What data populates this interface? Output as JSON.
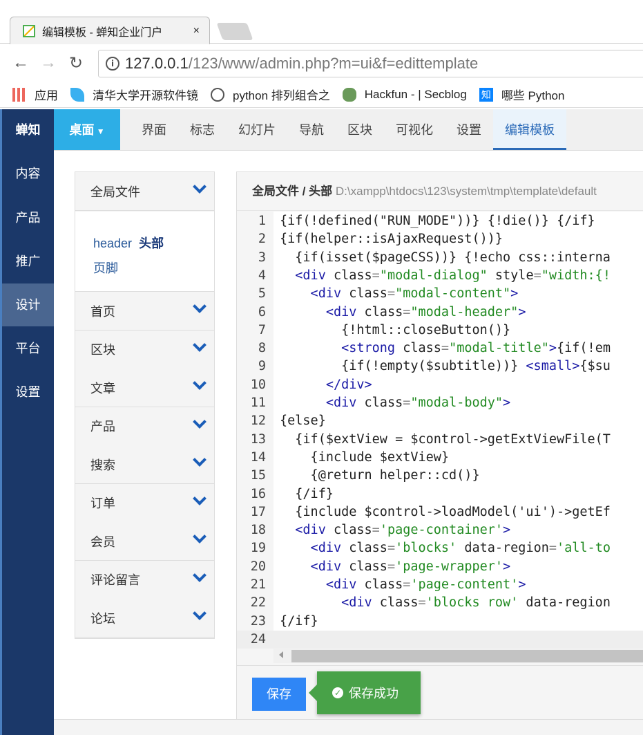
{
  "browser": {
    "tab_title": "编辑模板 - 蝉知企业门户",
    "tab_close": "×",
    "url_host": "127.0.0.1",
    "url_path": "/123/www/admin.php?m=ui&f=edittemplate",
    "bookmarks": [
      "应用",
      "清华大学开源软件镜",
      "python 排列组合之",
      "Hackfun - | Secblog",
      "哪些 Python"
    ]
  },
  "sidebar": {
    "brand": "蝉知",
    "items": [
      "内容",
      "产品",
      "推广",
      "设计",
      "平台",
      "设置"
    ],
    "active": "设计"
  },
  "topnav": {
    "desktop": "桌面",
    "items": [
      "界面",
      "标志",
      "幻灯片",
      "导航",
      "区块",
      "可视化",
      "设置",
      "编辑模板"
    ],
    "active": "编辑模板"
  },
  "filetree": {
    "open_group": "全局文件",
    "open_items": [
      {
        "code": "header",
        "label": "头部"
      },
      {
        "label": "页脚"
      }
    ],
    "groups": [
      "首页",
      "区块",
      "文章",
      "产品",
      "搜索",
      "订单",
      "会员",
      "评论留言",
      "论坛"
    ]
  },
  "editor": {
    "breadcrumb": "全局文件 / 头部",
    "path": "D:\\xampp\\htdocs\\123\\system\\tmp\\template\\default",
    "lines": [
      [
        [
          "txt",
          "{if(!defined(\"RUN_MODE\"))} {!die()} {/if}"
        ]
      ],
      [
        [
          "txt",
          "{if(helper::isAjaxRequest())}"
        ]
      ],
      [
        [
          "txt",
          "  {if(isset($pageCSS))} {!echo css::interna"
        ]
      ],
      [
        [
          "tag",
          "  <div "
        ],
        [
          "txt",
          "class"
        ],
        [
          "eq",
          "="
        ],
        [
          "str",
          "\"modal-dialog\""
        ],
        [
          "txt",
          " style"
        ],
        [
          "eq",
          "="
        ],
        [
          "str",
          "\"width:{!"
        ]
      ],
      [
        [
          "tag",
          "    <div "
        ],
        [
          "txt",
          "class"
        ],
        [
          "eq",
          "="
        ],
        [
          "str",
          "\"modal-content\""
        ],
        [
          "tag",
          ">"
        ]
      ],
      [
        [
          "tag",
          "      <div "
        ],
        [
          "txt",
          "class"
        ],
        [
          "eq",
          "="
        ],
        [
          "str",
          "\"modal-header\""
        ],
        [
          "tag",
          ">"
        ]
      ],
      [
        [
          "txt",
          "        {!html::closeButton()}"
        ]
      ],
      [
        [
          "tag",
          "        <strong "
        ],
        [
          "txt",
          "class"
        ],
        [
          "eq",
          "="
        ],
        [
          "str",
          "\"modal-title\""
        ],
        [
          "tag",
          ">"
        ],
        [
          "txt",
          "{if(!em"
        ]
      ],
      [
        [
          "txt",
          "        {if(!empty($subtitle))} "
        ],
        [
          "tag",
          "<small>"
        ],
        [
          "txt",
          "{$su"
        ]
      ],
      [
        [
          "tag",
          "      </div>"
        ]
      ],
      [
        [
          "tag",
          "      <div "
        ],
        [
          "txt",
          "class"
        ],
        [
          "eq",
          "="
        ],
        [
          "str",
          "\"modal-body\""
        ],
        [
          "tag",
          ">"
        ]
      ],
      [
        [
          "txt",
          "{else}"
        ]
      ],
      [
        [
          "txt",
          "  {if($extView = $control->getExtViewFile(T"
        ]
      ],
      [
        [
          "txt",
          "    {include $extView}"
        ]
      ],
      [
        [
          "txt",
          "    {@return helper::cd()}"
        ]
      ],
      [
        [
          "txt",
          "  {/if}"
        ]
      ],
      [
        [
          "txt",
          "  {include $control->loadModel('ui')->getEf"
        ]
      ],
      [
        [
          "tag",
          "  <div "
        ],
        [
          "txt",
          "class"
        ],
        [
          "eq",
          "="
        ],
        [
          "str",
          "'page-container'"
        ],
        [
          "tag",
          ">"
        ]
      ],
      [
        [
          "tag",
          "    <div "
        ],
        [
          "txt",
          "class"
        ],
        [
          "eq",
          "="
        ],
        [
          "str",
          "'blocks'"
        ],
        [
          "txt",
          " data-region"
        ],
        [
          "eq",
          "="
        ],
        [
          "str",
          "'all-to"
        ]
      ],
      [
        [
          "tag",
          "    <div "
        ],
        [
          "txt",
          "class"
        ],
        [
          "eq",
          "="
        ],
        [
          "str",
          "'page-wrapper'"
        ],
        [
          "tag",
          ">"
        ]
      ],
      [
        [
          "tag",
          "      <div "
        ],
        [
          "txt",
          "class"
        ],
        [
          "eq",
          "="
        ],
        [
          "str",
          "'page-content'"
        ],
        [
          "tag",
          ">"
        ]
      ],
      [
        [
          "tag",
          "        <div "
        ],
        [
          "txt",
          "class"
        ],
        [
          "eq",
          "="
        ],
        [
          "str",
          "'blocks row'"
        ],
        [
          "txt",
          " data-region"
        ]
      ],
      [
        [
          "txt",
          "{/if}"
        ]
      ],
      [
        [
          "txt",
          ""
        ]
      ]
    ],
    "save_label": "保存",
    "toast": "保存成功"
  },
  "colors": {
    "sidebar": "#1b3869",
    "accent": "#2daee6",
    "save": "#2f86f6",
    "toast": "#48a248"
  }
}
